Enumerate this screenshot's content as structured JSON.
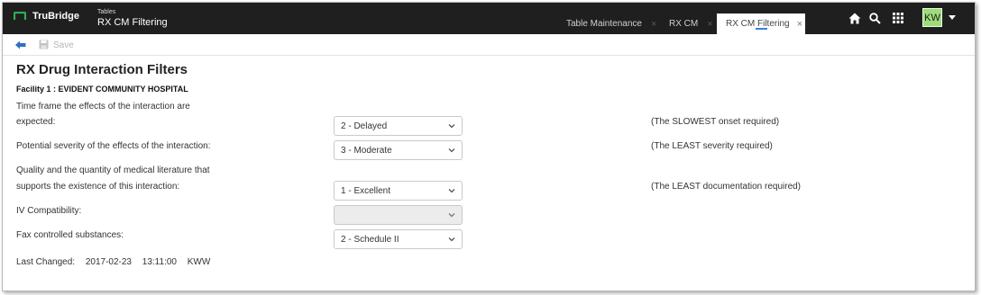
{
  "header": {
    "logo_text": "TruBridge",
    "breadcrumb_parent": "Tables",
    "breadcrumb_title": "RX CM Filtering",
    "tabs": [
      {
        "label": "Table Maintenance",
        "close": "×"
      },
      {
        "label": "RX CM",
        "close": "×"
      },
      {
        "label": "RX CM Filtering",
        "close": "×"
      }
    ],
    "icons": [
      "home-icon",
      "search-icon",
      "apps-grid-icon"
    ],
    "avatar_initials": "KW",
    "colors": {
      "bar": "#1f1f1f",
      "avatar": "#9ddc7a",
      "logo_green": "#2fae5b",
      "accent": "#3b7fd4"
    }
  },
  "toolbar": {
    "save_label": "Save"
  },
  "main": {
    "title": "RX Drug Interaction Filters",
    "facility": "Facility 1 : EVIDENT COMMUNITY HOSPITAL",
    "rows": [
      {
        "label_line1": "Time frame the effects of the interaction are",
        "label_line2": "expected:",
        "value": "2 - Delayed",
        "note": "(The SLOWEST onset required)"
      },
      {
        "label_line1": "Potential severity of the effects of the interaction:",
        "value": "3 - Moderate",
        "note": "(The LEAST severity required)"
      },
      {
        "label_line1": "Quality and the quantity of medical literature that",
        "label_line2": "supports the existence of this interaction:",
        "value": "1 - Excellent",
        "note": "(The LEAST documentation required)"
      },
      {
        "label_line1": "IV Compatibility:",
        "value": ""
      },
      {
        "label_line1": "Fax controlled substances:",
        "value": "2 - Schedule II"
      }
    ],
    "last_changed": {
      "label": "Last Changed:",
      "date": "2017-02-23",
      "time": "13:11:00",
      "user": "KWW"
    }
  }
}
